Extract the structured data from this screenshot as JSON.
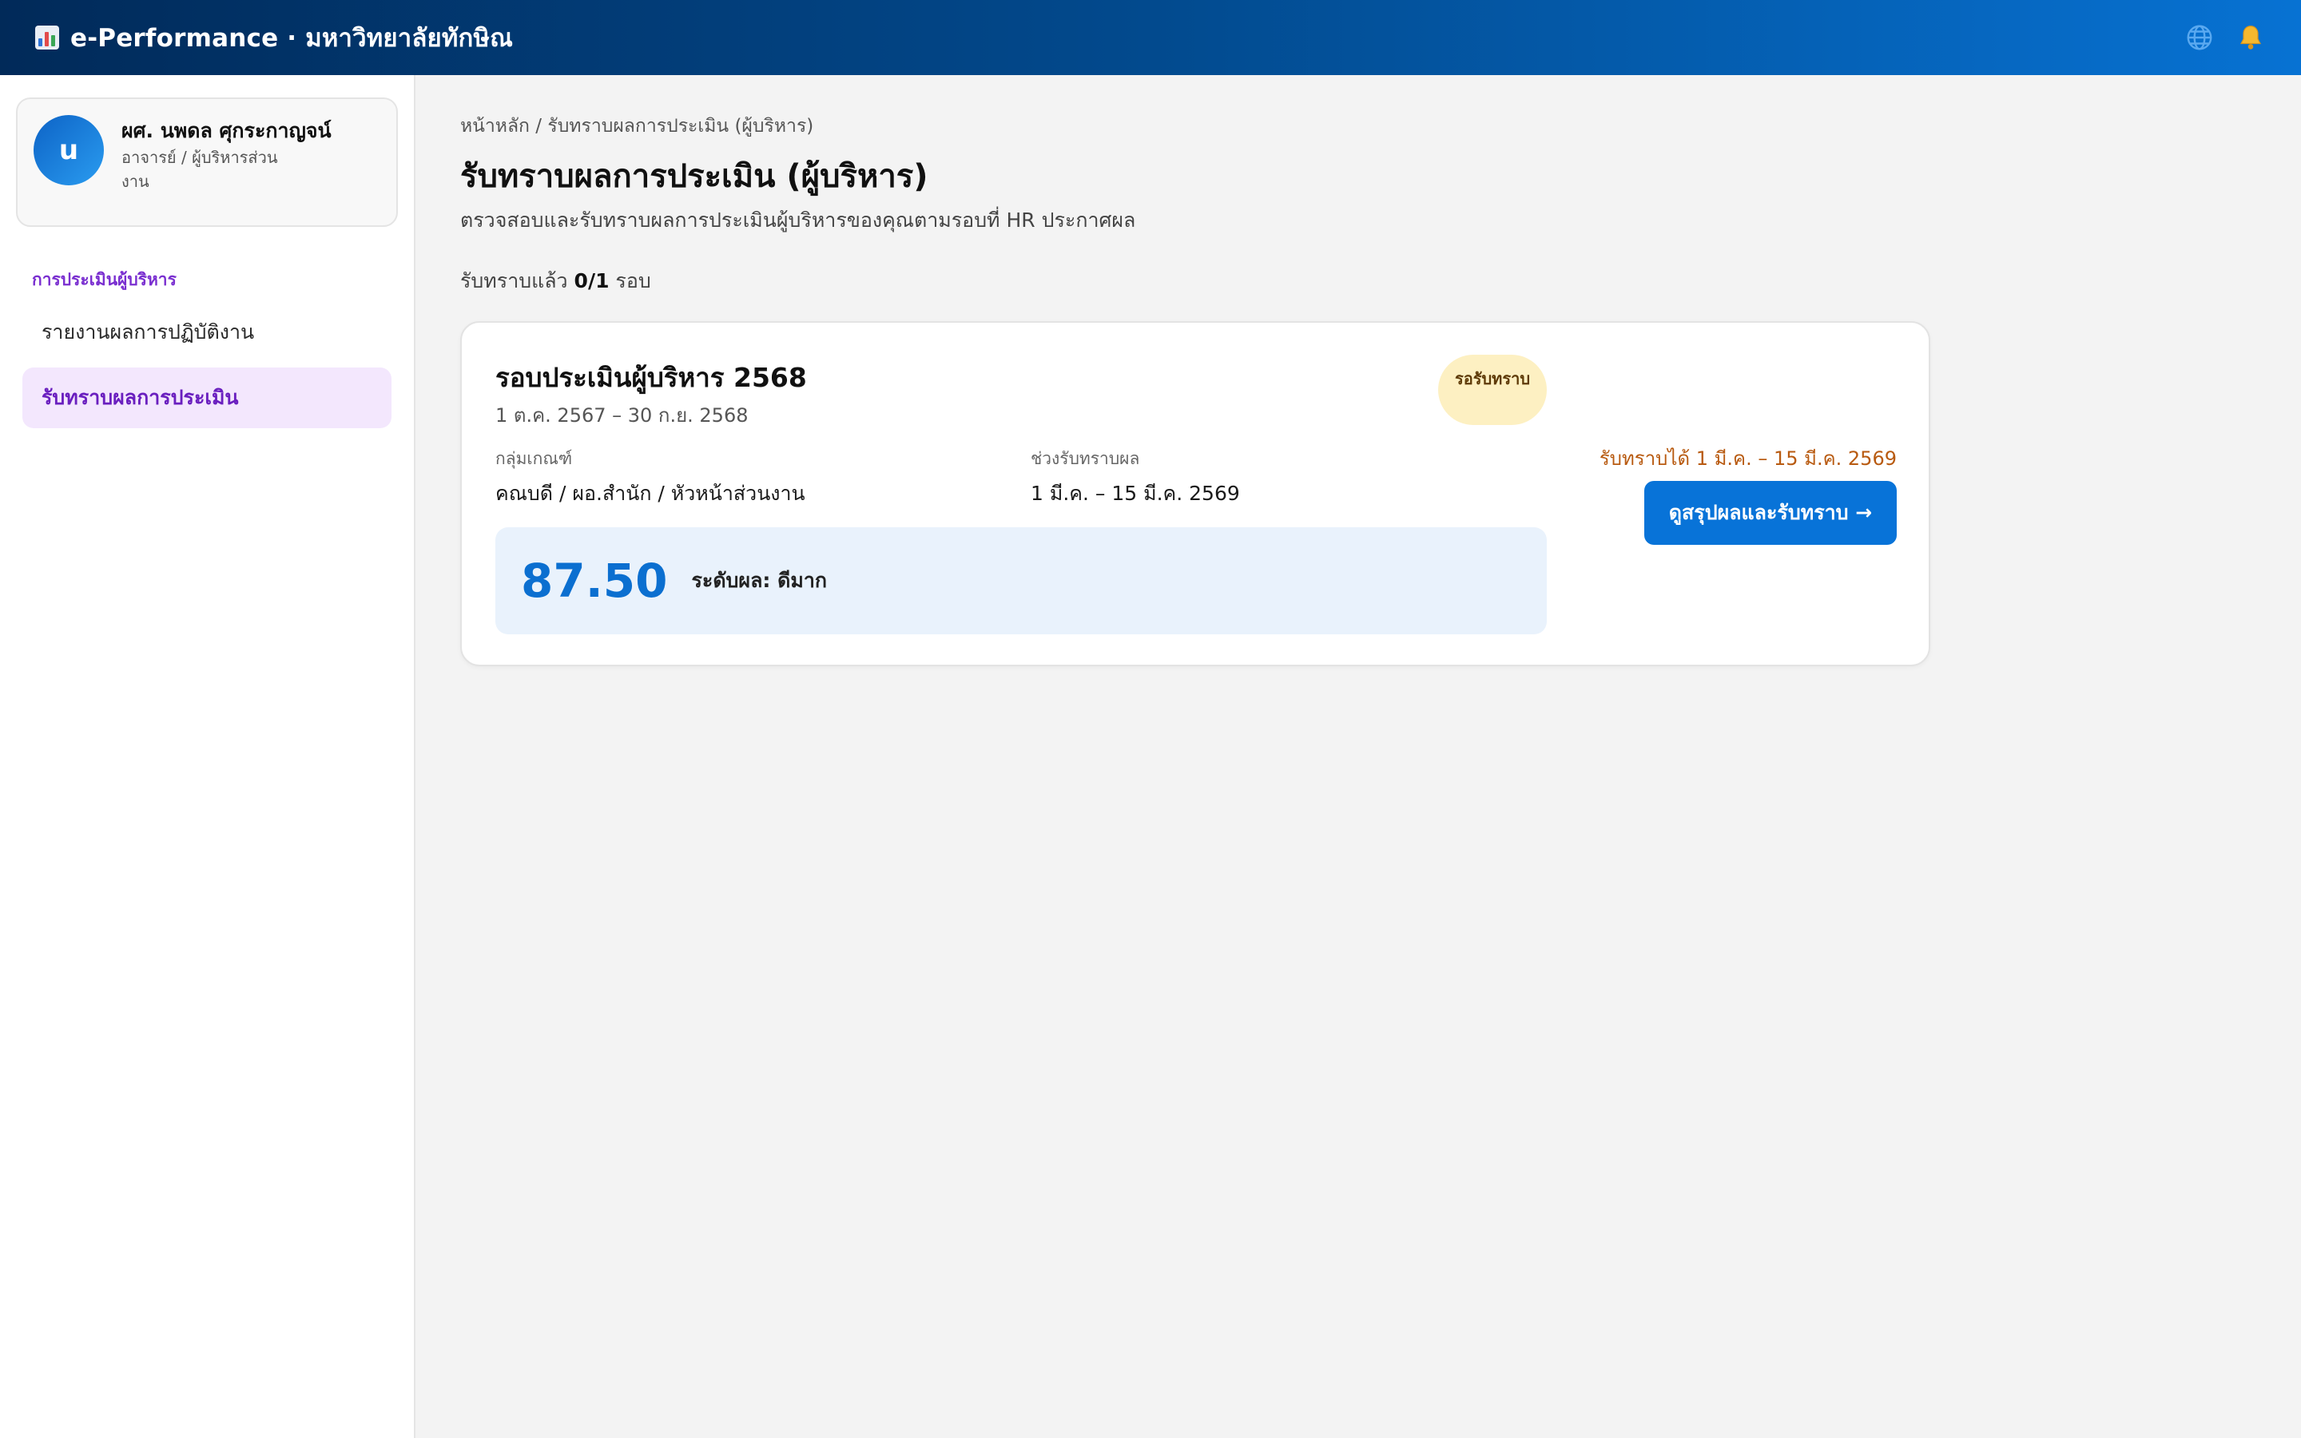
{
  "app": {
    "title": "e-Performance · มหาวิทยาลัยทักษิณ",
    "brand_colors": [
      "#012a59",
      "#0772d3"
    ],
    "icons": [
      "bar-chart-logo-icon",
      "globe-icon",
      "bell-icon"
    ]
  },
  "profile": {
    "initial": "u",
    "name": "ผศ. นพดล ศุกระกาญจน์",
    "role": "อาจารย์ / ผู้บริหารส่วนงาน"
  },
  "sidebar": {
    "section_label": "การประเมินผู้บริหาร",
    "items": [
      {
        "label": "รายงานผลการปฏิบัติงาน",
        "active": false
      },
      {
        "label": "รับทราบผลการประเมิน",
        "active": true
      }
    ]
  },
  "main": {
    "breadcrumb": "หน้าหลัก / รับทราบผลการประเมิน (ผู้บริหาร)",
    "title": "รับทราบผลการประเมิน (ผู้บริหาร)",
    "subtitle": "ตรวจสอบและรับทราบผลการประเมินผู้บริหารของคุณตามรอบที่ HR ประกาศผล",
    "ack_prefix": "รับทราบแล้ว",
    "ack_count": "0/1",
    "ack_suffix": "รอบ"
  },
  "round": {
    "title": "รอบประเมินผู้บริหาร 2568",
    "dates": "1 ต.ค. 2567 – 30 ก.ย. 2568",
    "status": "รอรับทราบ",
    "status_color": "#fdf0c2",
    "group_label": "กลุ่มเกณฑ์",
    "group_value": "คณบดี / ผอ.สำนัก / หัวหน้าส่วนงาน",
    "period_label": "ช่วงรับทราบผล",
    "period_value": "1 มี.ค. – 15 มี.ค. 2569",
    "score": "87.50",
    "level": "ระดับผล: ดีมาก",
    "ack_window": "รับทราบได้ 1 มี.ค. – 15 มี.ค. 2569",
    "action_label": "ดูสรุปผลและรับทราบ →"
  }
}
